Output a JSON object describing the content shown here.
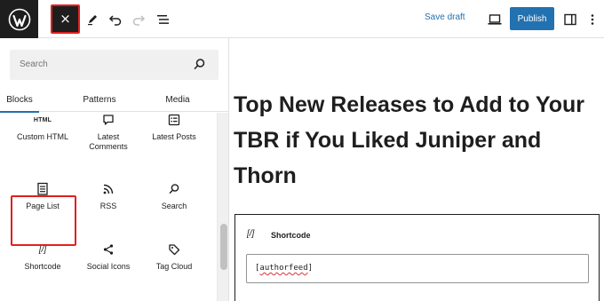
{
  "toolbar": {
    "close_glyph": "×",
    "save_draft": "Save draft",
    "publish": "Publish"
  },
  "sidebar": {
    "search_placeholder": "Search",
    "tabs": [
      {
        "label": "Blocks",
        "active": true
      },
      {
        "label": "Patterns",
        "active": false
      },
      {
        "label": "Media",
        "active": false
      }
    ],
    "blocks": [
      {
        "label": "Custom HTML",
        "icon": "html-icon",
        "icon_text": "HTML"
      },
      {
        "label": "Latest Comments",
        "icon": "comment-icon"
      },
      {
        "label": "Latest Posts",
        "icon": "list-icon"
      },
      {
        "label": "Page List",
        "icon": "page-list-icon"
      },
      {
        "label": "RSS",
        "icon": "rss-icon"
      },
      {
        "label": "Search",
        "icon": "search-icon"
      },
      {
        "label": "Shortcode",
        "icon": "shortcode-icon",
        "icon_text": "[/]"
      },
      {
        "label": "Social Icons",
        "icon": "share-icon"
      },
      {
        "label": "Tag Cloud",
        "icon": "tag-icon"
      }
    ]
  },
  "editor": {
    "title": "Top New Releases to Add to Your TBR if You Liked Juniper and Thorn",
    "shortcode_block": {
      "icon_text": "[/]",
      "label": "Shortcode",
      "value_prefix": "[",
      "value_word": "authorfeed",
      "value_suffix": "]"
    }
  },
  "colors": {
    "accent": "#2271b1",
    "highlight": "#e02020",
    "dark": "#1e1e1e"
  }
}
